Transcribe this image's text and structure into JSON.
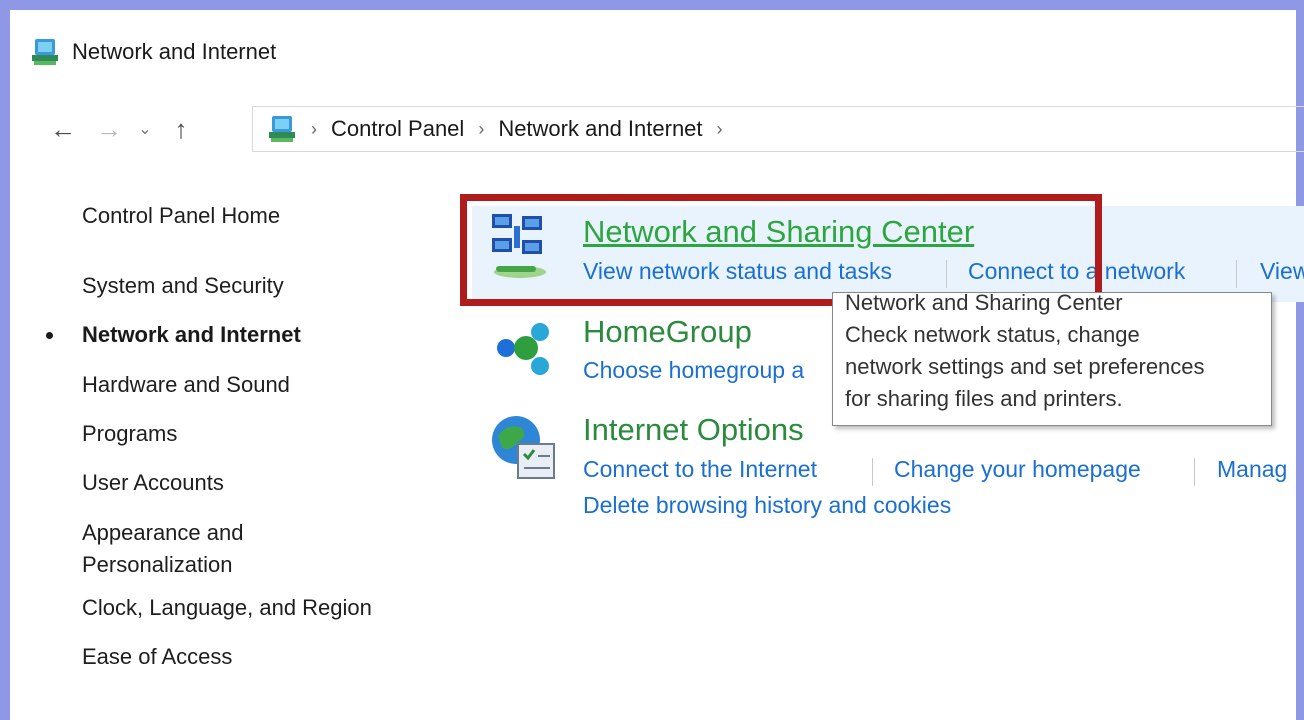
{
  "window": {
    "title": "Network and Internet",
    "frame_color": "#8e98e4"
  },
  "nav": {
    "back_icon": "arrow-left-icon",
    "forward_icon": "arrow-right-icon",
    "recent_icon": "chevron-down-icon",
    "up_icon": "arrow-up-icon",
    "sep": "›",
    "breadcrumbs": [
      "Control Panel",
      "Network and Internet"
    ]
  },
  "sidebar": {
    "home": "Control Panel Home",
    "items": [
      {
        "label": "System and Security",
        "active": false
      },
      {
        "label": "Network and Internet",
        "active": true
      },
      {
        "label": "Hardware and Sound",
        "active": false
      },
      {
        "label": "Programs",
        "active": false
      },
      {
        "label": "User Accounts",
        "active": false
      },
      {
        "label": "Appearance and",
        "label2": "Personalization",
        "active": false
      },
      {
        "label": "Clock, Language, and Region",
        "active": false
      },
      {
        "label": "Ease of Access",
        "active": false
      }
    ]
  },
  "categories": [
    {
      "title": "Network and Sharing Center",
      "icon": "network-sharing-icon",
      "tasks": [
        "View network status and tasks",
        "Connect to a network",
        "View"
      ]
    },
    {
      "title": "HomeGroup",
      "icon": "homegroup-icon",
      "tasks": [
        "Choose homegroup a"
      ]
    },
    {
      "title": "Internet Options",
      "icon": "internet-options-icon",
      "tasks": [
        "Connect to the Internet",
        "Change your homepage",
        "Manag",
        "Delete browsing history and cookies"
      ]
    }
  ],
  "tooltip": {
    "title": "Network and Sharing Center",
    "lines": [
      "Check network status, change",
      "network settings and set preferences",
      "for sharing files and printers."
    ]
  },
  "colors": {
    "highlight": "#b01c1c",
    "link": "#1a6fd1",
    "title_green": "#2ea640"
  }
}
